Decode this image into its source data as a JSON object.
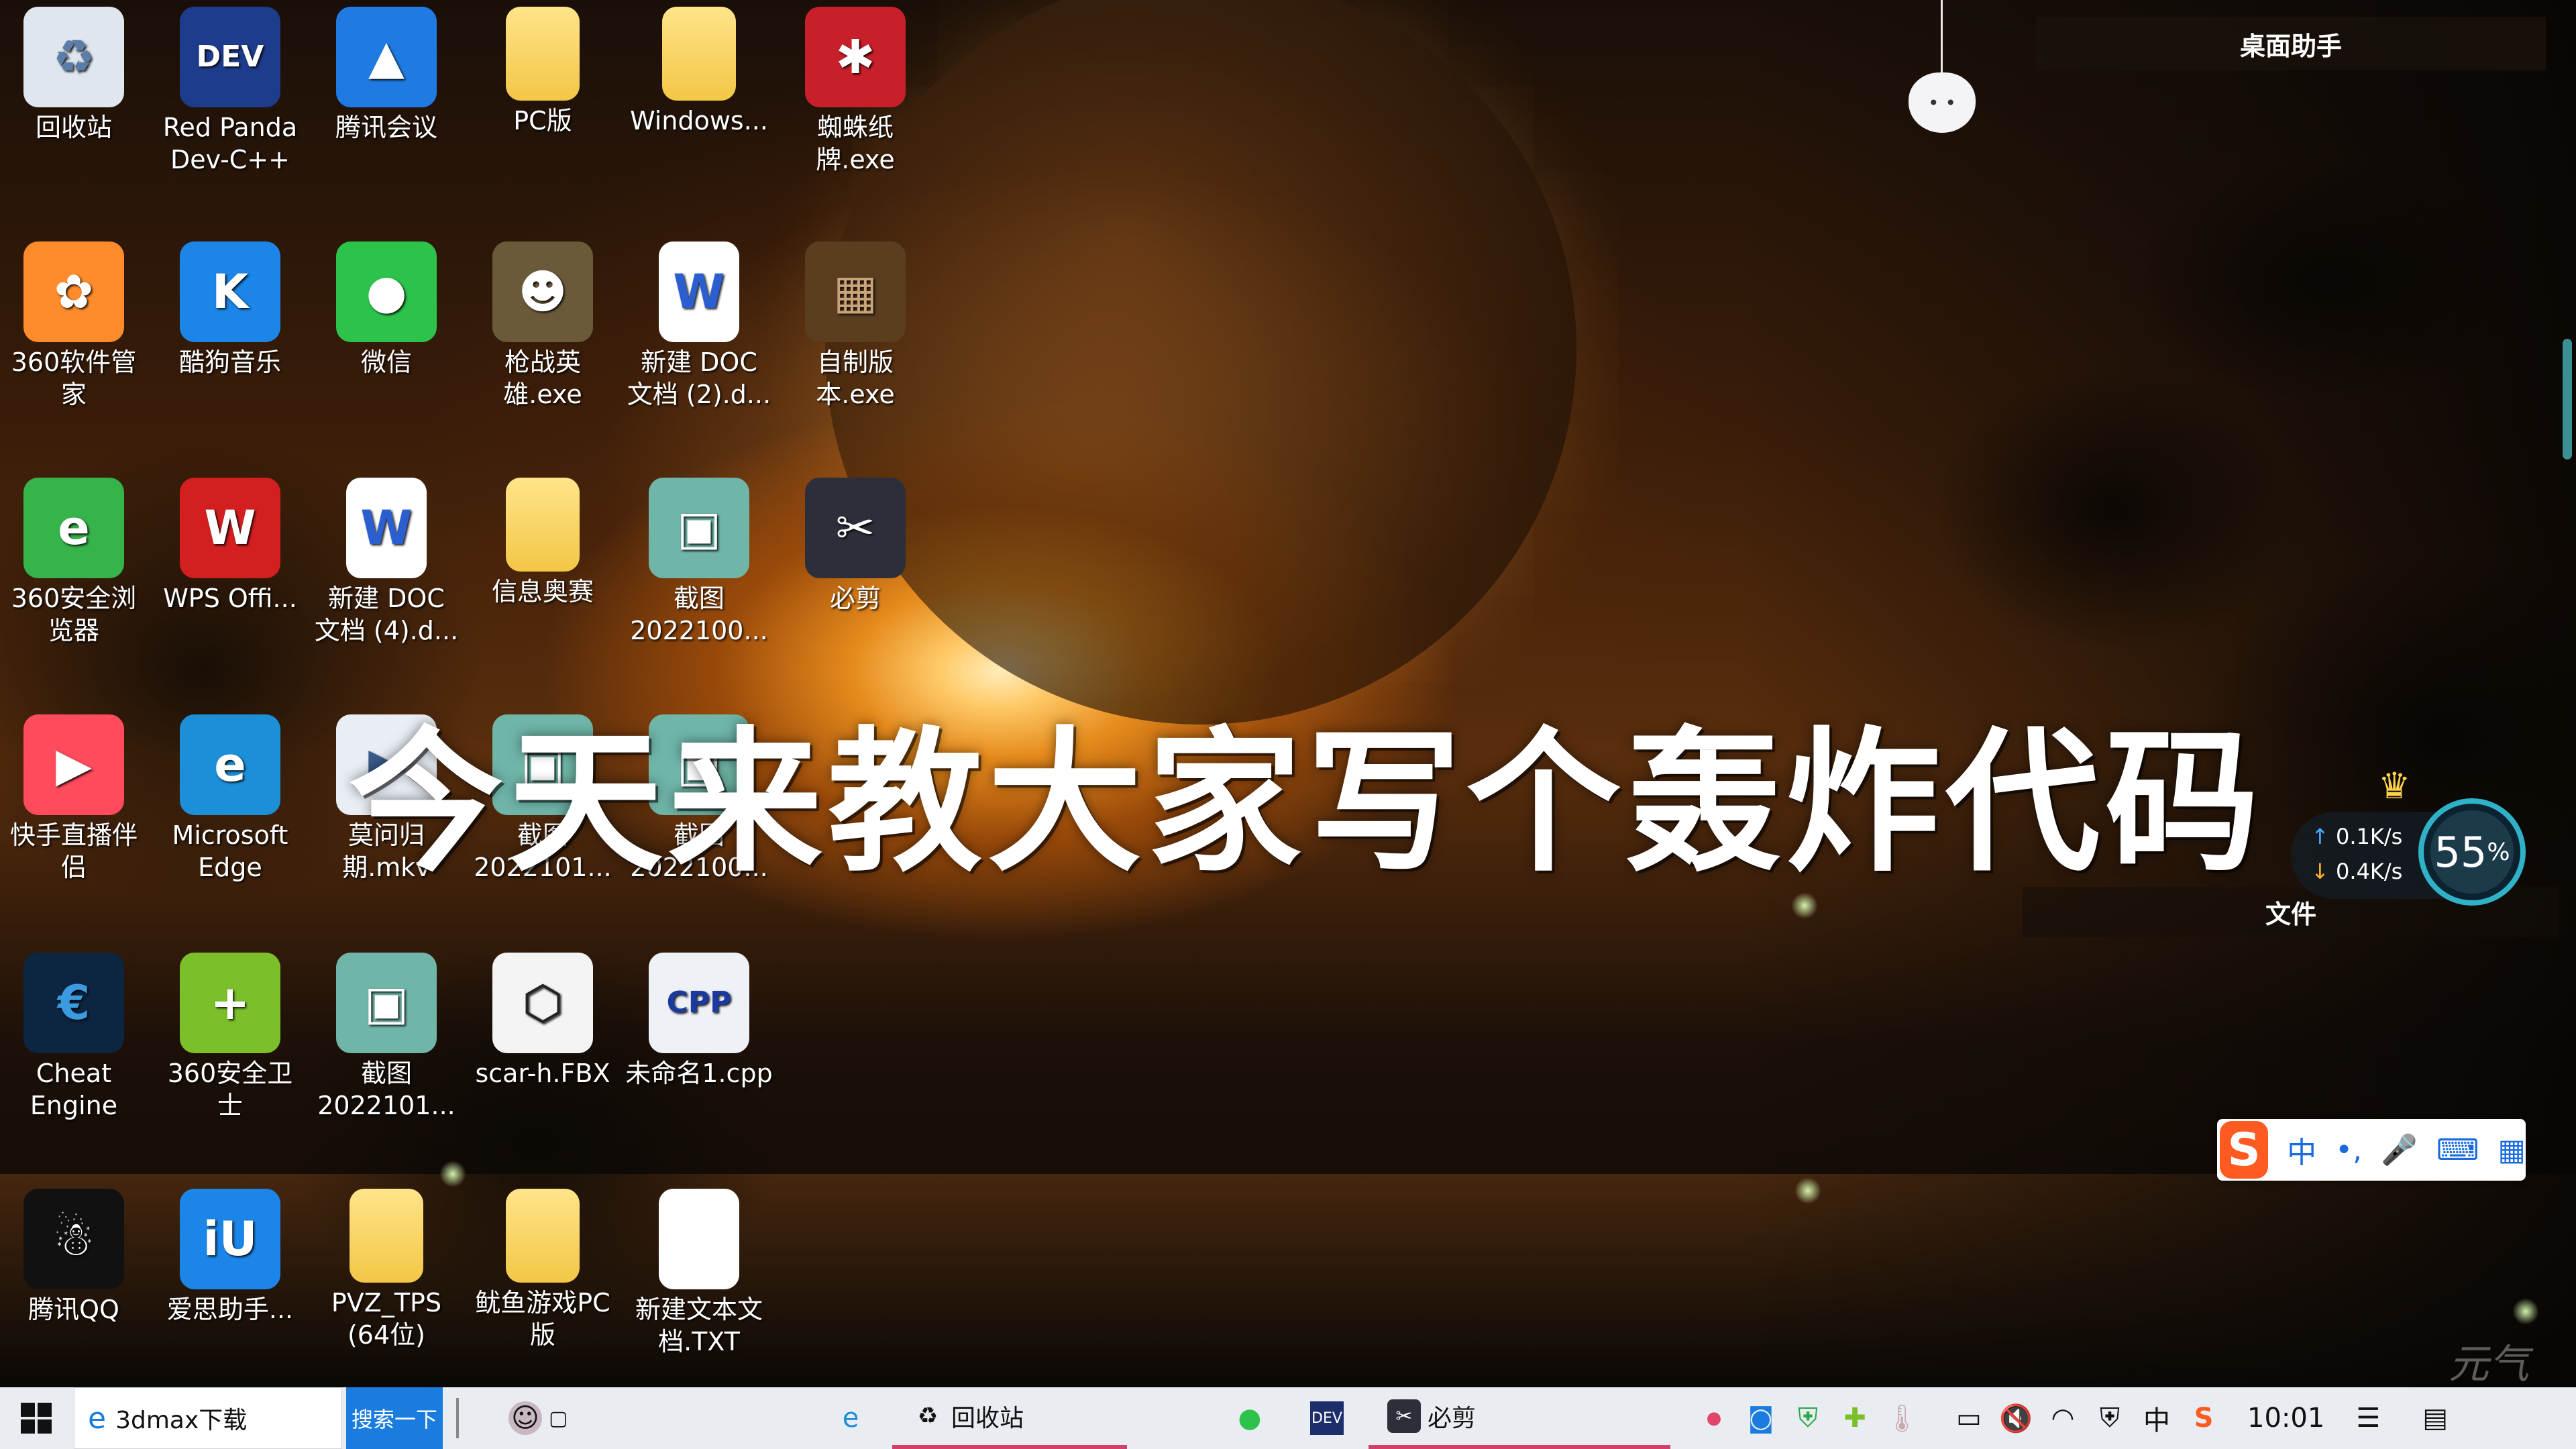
{
  "desktop_icons": [
    {
      "label": "回收站",
      "icon": "recycle-bin-icon",
      "glyph": "♻"
    },
    {
      "label": "Red Panda Dev-C++",
      "icon": "devcpp-icon",
      "glyph": "DEV"
    },
    {
      "label": "腾讯会议",
      "icon": "tencent-meeting-icon",
      "glyph": "▲"
    },
    {
      "label": "PC版",
      "icon": "folder-icon",
      "glyph": ""
    },
    {
      "label": "Windows...",
      "icon": "folder-icon",
      "glyph": ""
    },
    {
      "label": "蜘蛛纸牌.exe",
      "icon": "spider-solitaire-icon",
      "glyph": "✱"
    },
    {
      "label": "360软件管家",
      "icon": "360-software-manager-icon",
      "glyph": "✿"
    },
    {
      "label": "酷狗音乐",
      "icon": "kugou-music-icon",
      "glyph": "K"
    },
    {
      "label": "微信",
      "icon": "wechat-icon",
      "glyph": "●"
    },
    {
      "label": "枪战英雄.exe",
      "icon": "gun-hero-game-icon",
      "glyph": "☻"
    },
    {
      "label": "新建 DOC 文档 (2).d...",
      "icon": "word-document-icon",
      "glyph": "W"
    },
    {
      "label": "自制版本.exe",
      "icon": "minecraft-icon",
      "glyph": "▦"
    },
    {
      "label": "360安全浏览器",
      "icon": "360-browser-icon",
      "glyph": "e"
    },
    {
      "label": "WPS Offi...",
      "icon": "wps-office-icon",
      "glyph": "W"
    },
    {
      "label": "新建 DOC 文档 (4).d...",
      "icon": "word-document-icon",
      "glyph": "W"
    },
    {
      "label": "信息奥赛",
      "icon": "folder-icon",
      "glyph": ""
    },
    {
      "label": "截图 2022100...",
      "icon": "screenshot-image-icon",
      "glyph": "▣"
    },
    {
      "label": "必剪",
      "icon": "bijian-editor-icon",
      "glyph": "✂"
    },
    {
      "label": "快手直播伴侣",
      "icon": "kuaishou-live-icon",
      "glyph": "▶"
    },
    {
      "label": "Microsoft Edge",
      "icon": "edge-icon",
      "glyph": "e"
    },
    {
      "label": "莫问归期.mkv",
      "icon": "video-file-icon",
      "glyph": "▶"
    },
    {
      "label": "截图 2022101...",
      "icon": "screenshot-image-icon",
      "glyph": "▣"
    },
    {
      "label": "截图 2022100...",
      "icon": "screenshot-image-icon",
      "glyph": "▣"
    },
    {
      "label": "Cheat Engine",
      "icon": "cheat-engine-icon",
      "glyph": "€"
    },
    {
      "label": "360安全卫士",
      "icon": "360-security-icon",
      "glyph": "+"
    },
    {
      "label": "截图 2022101...",
      "icon": "screenshot-image-icon",
      "glyph": "▣"
    },
    {
      "label": "scar-h.FBX",
      "icon": "fbx-file-icon",
      "glyph": "⬡"
    },
    {
      "label": "未命名1.cpp",
      "icon": "cpp-file-icon",
      "glyph": "CPP"
    },
    {
      "label": "腾讯QQ",
      "icon": "qq-icon",
      "glyph": "☃"
    },
    {
      "label": "爱思助手...",
      "icon": "i4-assistant-icon",
      "glyph": "iU"
    },
    {
      "label": "PVZ_TPS (64位)",
      "icon": "folder-icon",
      "glyph": ""
    },
    {
      "label": "鱿鱼游戏PC版",
      "icon": "folder-icon",
      "glyph": ""
    },
    {
      "label": "新建文本文档.TXT",
      "icon": "text-file-icon",
      "glyph": ""
    }
  ],
  "caption": "今天来教大家写个轰炸代码",
  "desktop_assistant": {
    "title": "桌面助手",
    "files_label": "文件"
  },
  "net_widget": {
    "upload": "0.1K/s",
    "download": "0.4K/s",
    "percent": "55",
    "percent_unit": "%"
  },
  "ime_bar": {
    "logo": "S",
    "mode": "中",
    "items": [
      "•,",
      "🎤",
      "⌨",
      "▦"
    ]
  },
  "taskbar": {
    "search_value": "3dmax下载",
    "search_button": "搜索一下",
    "tasks": [
      {
        "label": "",
        "icon": "anime-avatar-icon"
      },
      {
        "label": "",
        "icon": "edge-icon"
      },
      {
        "label": "回收站",
        "icon": "recycle-bin-icon"
      },
      {
        "label": "",
        "icon": "wechat-icon"
      },
      {
        "label": "",
        "icon": "devcpp-icon"
      },
      {
        "label": "必剪",
        "icon": "bijian-editor-icon"
      }
    ],
    "tray": {
      "ime_mode": "中",
      "clock": "10:01"
    }
  },
  "watermark": "元气"
}
